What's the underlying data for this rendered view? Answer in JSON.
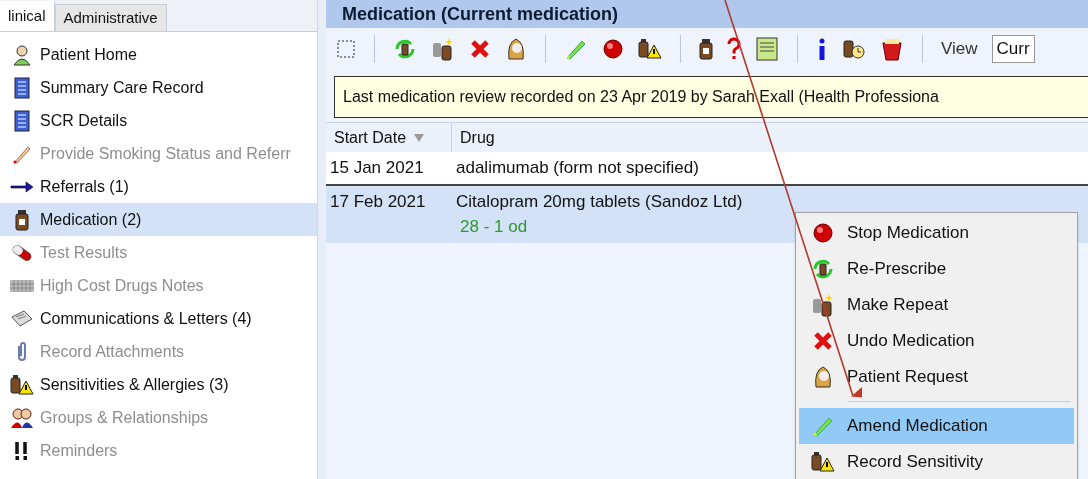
{
  "tabs": [
    {
      "label": "linical",
      "selected": true
    },
    {
      "label": "Administrative",
      "selected": false
    }
  ],
  "sidebar": {
    "items": [
      {
        "label": "Patient Home",
        "disabled": false,
        "selected": false
      },
      {
        "label": "Summary Care Record",
        "disabled": false,
        "selected": false
      },
      {
        "label": "SCR Details",
        "disabled": false,
        "selected": false
      },
      {
        "label": "Provide Smoking Status and Referr",
        "disabled": true,
        "selected": false
      },
      {
        "label": "Referrals (1)",
        "disabled": false,
        "selected": false
      },
      {
        "label": "Medication (2)",
        "disabled": false,
        "selected": true
      },
      {
        "label": "Test Results",
        "disabled": true,
        "selected": false
      },
      {
        "label": "High Cost Drugs Notes",
        "disabled": true,
        "selected": false
      },
      {
        "label": "Communications & Letters (4)",
        "disabled": false,
        "selected": false
      },
      {
        "label": "Record Attachments",
        "disabled": true,
        "selected": false
      },
      {
        "label": "Sensitivities & Allergies (3)",
        "disabled": false,
        "selected": false
      },
      {
        "label": "Groups & Relationships",
        "disabled": true,
        "selected": false
      },
      {
        "label": "Reminders",
        "disabled": true,
        "selected": false
      }
    ]
  },
  "panel": {
    "title": "Medication (Current medication)",
    "view": {
      "label": "View",
      "value": "Curr"
    },
    "banner": "Last medication review recorded on 23 Apr 2019 by Sarah Exall (Health Professiona",
    "table": {
      "columns": [
        "Start Date",
        "Drug"
      ],
      "rows": [
        {
          "start_date": "15 Jan 2021",
          "drug": "adalimumab (form not specified)",
          "selected": false
        },
        {
          "start_date": "17 Feb 2021",
          "drug": "Citalopram 20mg tablets (Sandoz Ltd)",
          "detail": "28 - 1 od",
          "selected": true
        }
      ]
    }
  },
  "context_menu": {
    "items": [
      {
        "label": "Stop Medication",
        "selected": false
      },
      {
        "label": "Re-Prescribe",
        "selected": false
      },
      {
        "label": "Make Repeat",
        "selected": false
      },
      {
        "label": "Undo Medication",
        "selected": false
      },
      {
        "label": "Patient Request",
        "selected": false,
        "separator_after": true
      },
      {
        "label": "Amend Medication",
        "selected": true
      },
      {
        "label": "Record Sensitivity",
        "selected": false
      }
    ]
  }
}
